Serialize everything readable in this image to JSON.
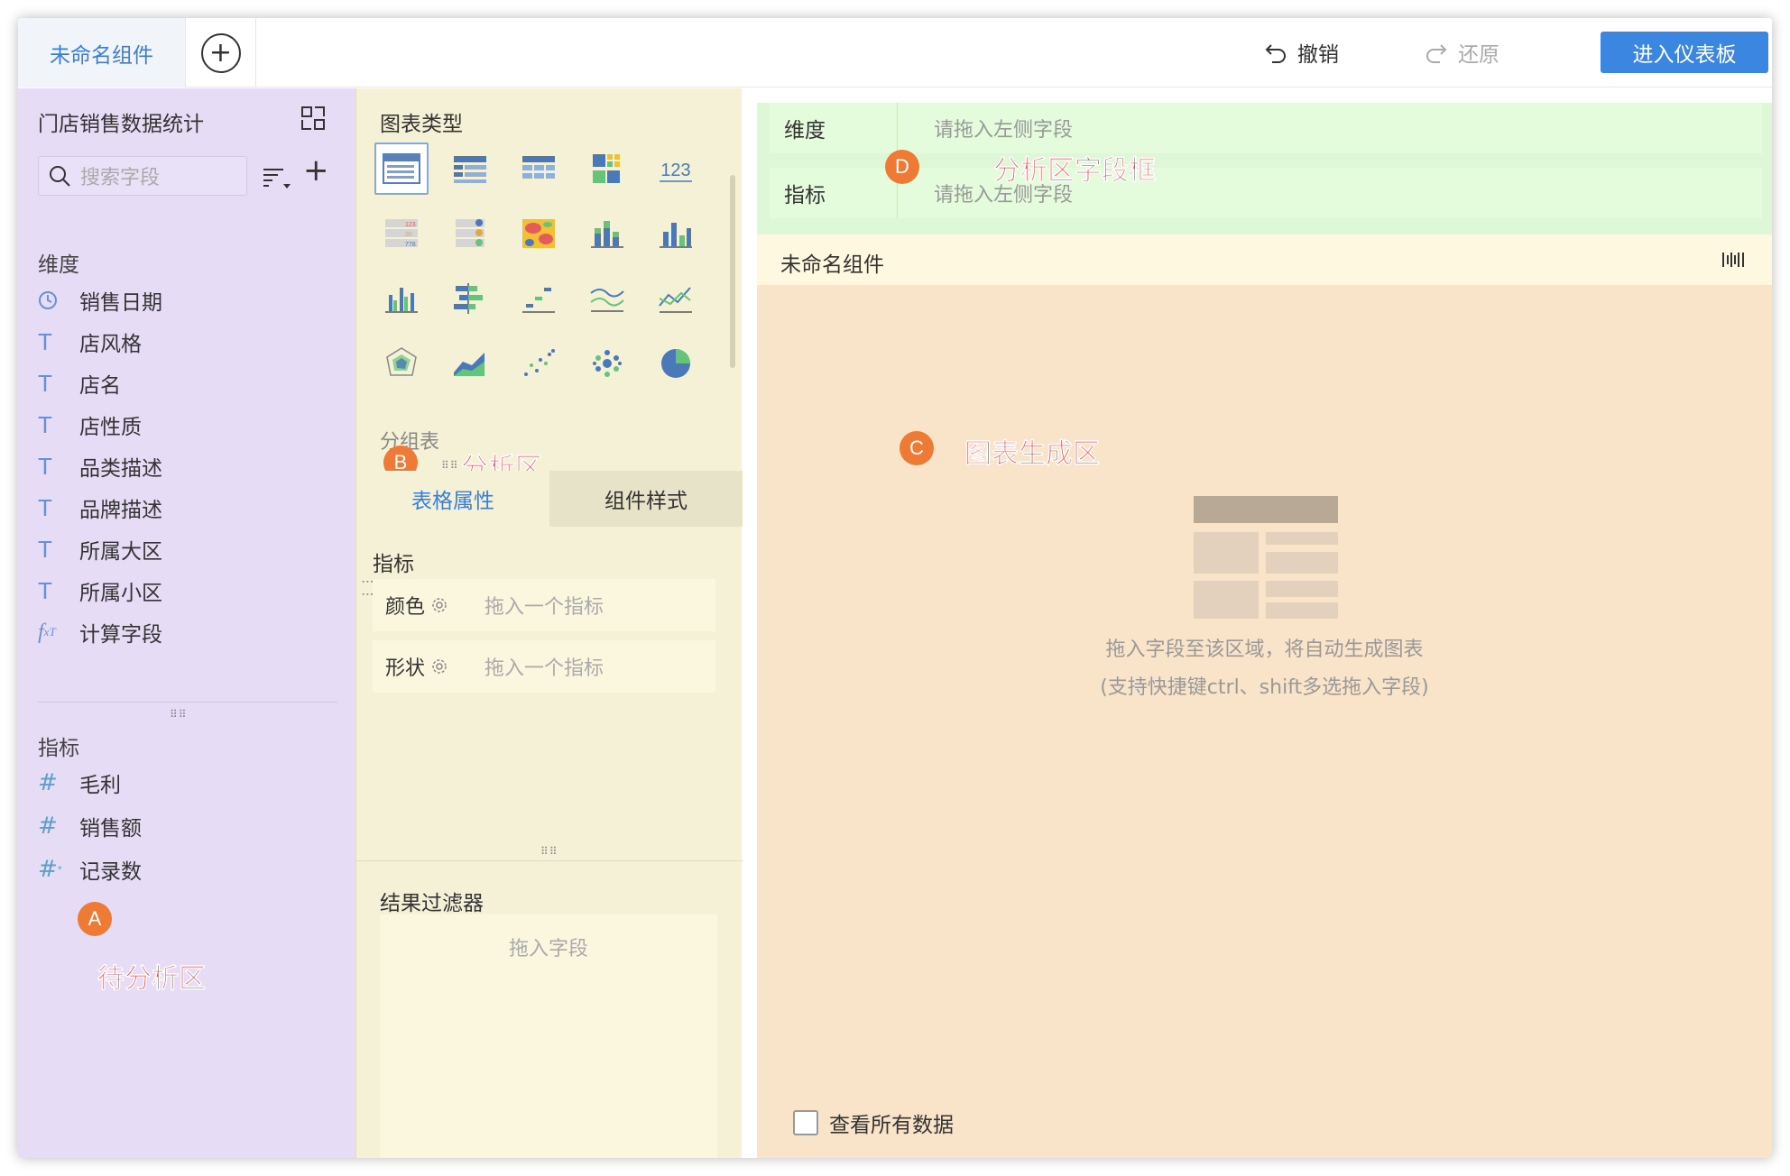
{
  "topbar": {
    "active_tab": "未命名组件",
    "undo_label": "撤销",
    "redo_label": "还原",
    "enter_dashboard_label": "进入仪表板"
  },
  "left": {
    "dataset_title": "门店销售数据统计",
    "search_placeholder": "搜索字段",
    "dimensions_title": "维度",
    "dimensions": [
      {
        "type": "date",
        "label": "销售日期"
      },
      {
        "type": "text",
        "label": "店风格"
      },
      {
        "type": "text",
        "label": "店名"
      },
      {
        "type": "text",
        "label": "店性质"
      },
      {
        "type": "text",
        "label": "品类描述"
      },
      {
        "type": "text",
        "label": "品牌描述"
      },
      {
        "type": "text",
        "label": "所属大区"
      },
      {
        "type": "text",
        "label": "所属小区"
      },
      {
        "type": "calc",
        "label": "计算字段"
      }
    ],
    "measures_title": "指标",
    "measures": [
      {
        "type": "number",
        "label": "毛利"
      },
      {
        "type": "number",
        "label": "销售额"
      },
      {
        "type": "count",
        "label": "记录数"
      }
    ],
    "marker": "A",
    "region_label": "待分析区"
  },
  "middle": {
    "chart_types_title": "图表类型",
    "chart_icons": [
      "group-table-icon",
      "detail-table-icon",
      "cross-table-icon",
      "color-table-icon",
      "kpi-number-icon",
      "kpi-list-icon",
      "kpi-dot-icon",
      "heatmap-icon",
      "stacked-bar-icon",
      "column-icon",
      "grouped-column-icon",
      "bar-icon",
      "step-icon",
      "wave-line-icon",
      "line-icon",
      "radar-icon",
      "area-icon",
      "scatter-icon",
      "bubble-icon",
      "pie-icon"
    ],
    "selected_chart_label": "分组表",
    "marker": "B",
    "region_label": "分析区",
    "tab_table_props": "表格属性",
    "tab_component_style": "组件样式",
    "measures_title": "指标",
    "color_label": "颜色",
    "color_placeholder": "拖入一个指标",
    "shape_label": "形状",
    "shape_placeholder": "拖入一个指标",
    "filter_title": "结果过滤器",
    "filter_placeholder": "拖入字段"
  },
  "right": {
    "dimension_label": "维度",
    "dimension_placeholder": "请拖入左侧字段",
    "measure_label": "指标",
    "measure_placeholder": "请拖入左侧字段",
    "marker_d": "D",
    "region_label_d": "分析区字段框",
    "component_title": "未命名组件",
    "marker_c": "C",
    "region_label_c": "图表生成区",
    "hint_line1": "拖入字段至该区域，将自动生成图表",
    "hint_line2": "(支持快捷键ctrl、shift多选拖入字段)",
    "view_all_label": "查看所有数据"
  },
  "colors": {
    "accent": "#3b86e0",
    "left_bg": "#e6dcf6",
    "middle_bg": "#f4f1d7",
    "dropzone_bg": "#def7d6",
    "chart_area_bg": "#f9e3c9",
    "marker": "#ee7a35",
    "region_label": "#e4474f"
  }
}
